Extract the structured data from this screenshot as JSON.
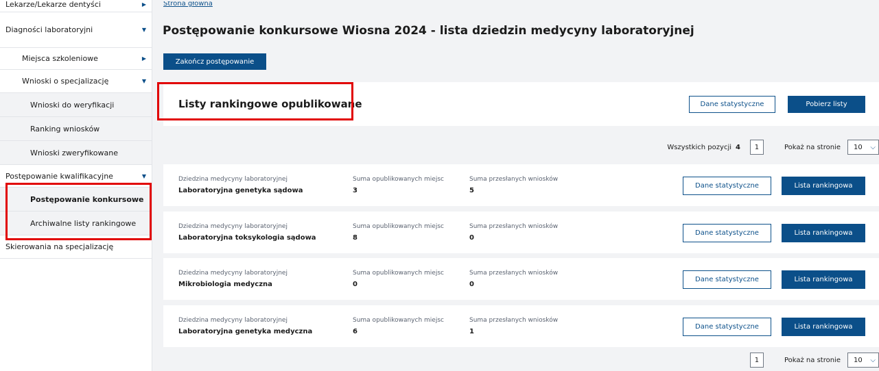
{
  "sidebar": {
    "items": [
      {
        "label": "Lekarze/Lekarze dentyści",
        "arrow": "▶"
      },
      {
        "label": "Diagności laboratoryjni",
        "arrow": "▼"
      },
      {
        "label": "Miejsca szkoleniowe",
        "arrow": "▶"
      },
      {
        "label": "Wnioski o specjalizację",
        "arrow": "▼"
      },
      {
        "label": "Wnioski do weryfikacji"
      },
      {
        "label": "Ranking wniosków"
      },
      {
        "label": "Wnioski zweryfikowane"
      },
      {
        "label": "Postępowanie kwalifikacyjne",
        "arrow": "▼"
      },
      {
        "label": "Postępowanie konkursowe"
      },
      {
        "label": "Archiwalne listy rankingowe"
      },
      {
        "label": "Skierowania na specjalizację"
      }
    ]
  },
  "main": {
    "breadcrumb": "Strona główna",
    "title": "Postępowanie konkursowe Wiosna 2024 - lista dziedzin medycyny laboratoryjnej",
    "end_button": "Zakończ postępowanie",
    "header_card": {
      "title": "Listy rankingowe opublikowane",
      "stats_button": "Dane statystyczne",
      "download_button": "Pobierz listy"
    },
    "pager": {
      "total_label": "Wszystkich pozycji",
      "total_value": "4",
      "page": "1",
      "per_page_label": "Pokaż na stronie",
      "per_page_value": "10"
    },
    "rows": [
      {
        "field_label": "Dziedzina medycyny laboratoryjnej",
        "field": "Laboratoryjna genetyka sądowa",
        "places_label": "Suma opublikowanych miejsc",
        "places": "3",
        "apps_label": "Suma przesłanych wniosków",
        "apps": "5",
        "stats_button": "Dane statystyczne",
        "ranking_button": "Lista rankingowa"
      },
      {
        "field_label": "Dziedzina medycyny laboratoryjnej",
        "field": "Laboratoryjna toksykologia sądowa",
        "places_label": "Suma opublikowanych miejsc",
        "places": "8",
        "apps_label": "Suma przesłanych wniosków",
        "apps": "0",
        "stats_button": "Dane statystyczne",
        "ranking_button": "Lista rankingowa"
      },
      {
        "field_label": "Dziedzina medycyny laboratoryjnej",
        "field": "Mikrobiologia medyczna",
        "places_label": "Suma opublikowanych miejsc",
        "places": "0",
        "apps_label": "Suma przesłanych wniosków",
        "apps": "0",
        "stats_button": "Dane statystyczne",
        "ranking_button": "Lista rankingowa"
      },
      {
        "field_label": "Dziedzina medycyny laboratoryjnej",
        "field": "Laboratoryjna genetyka medyczna",
        "places_label": "Suma opublikowanych miejsc",
        "places": "6",
        "apps_label": "Suma przesłanych wniosków",
        "apps": "1",
        "stats_button": "Dane statystyczne",
        "ranking_button": "Lista rankingowa"
      }
    ]
  },
  "colors": {
    "primary": "#0b4f89",
    "highlight": "#e10000",
    "background": "#f2f3f5"
  },
  "icons": {
    "collapsed": "chevron-right-icon",
    "expanded": "chevron-down-icon"
  }
}
